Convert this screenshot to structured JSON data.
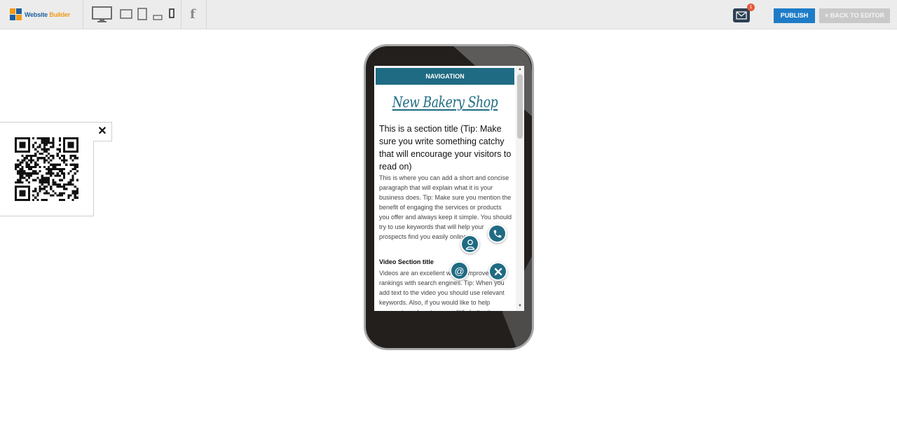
{
  "toolbar": {
    "logo_text_main": "Website",
    "logo_text_accent": "Builder",
    "device_icons": [
      "desktop-icon",
      "tablet-landscape-icon",
      "tablet-portrait-icon",
      "phone-landscape-icon",
      "phone-portrait-icon"
    ],
    "social_icon": "facebook-icon",
    "mail_badge_count": "1",
    "publish_label": "PUBLISH",
    "back_label": "× BACK TO EDITOR"
  },
  "qr": {
    "close_label": "✕"
  },
  "preview": {
    "nav_label": "NAVIGATION",
    "site_title": "New Bakery Shop",
    "section_title": "This is a section title (Tip: Make sure you write something catchy that will encourage your visitors to read on)",
    "section_body": "This is where you can add a short and concise paragraph that will explain what it is your business does. Tip: Make sure you mention the benefit of engaging the services or products you offer and always keep it simple. You should try to use keywords that will help your prospects find you easily online.",
    "video_title": "Video Section title",
    "video_body": "Videos are an excellent way to improve rankings with search engines. Tip: When you add text to the video you should use relevant keywords. Also, if you would like to help prospects and customers a little better it"
  },
  "fab_icons": [
    "phone-icon",
    "contact-person-icon",
    "email-at-icon",
    "close-icon"
  ],
  "fab_email_glyph": "@",
  "colors": {
    "accent": "#1f6b83",
    "publish": "#1e7cc7",
    "toolbar_bg": "#ececec"
  }
}
